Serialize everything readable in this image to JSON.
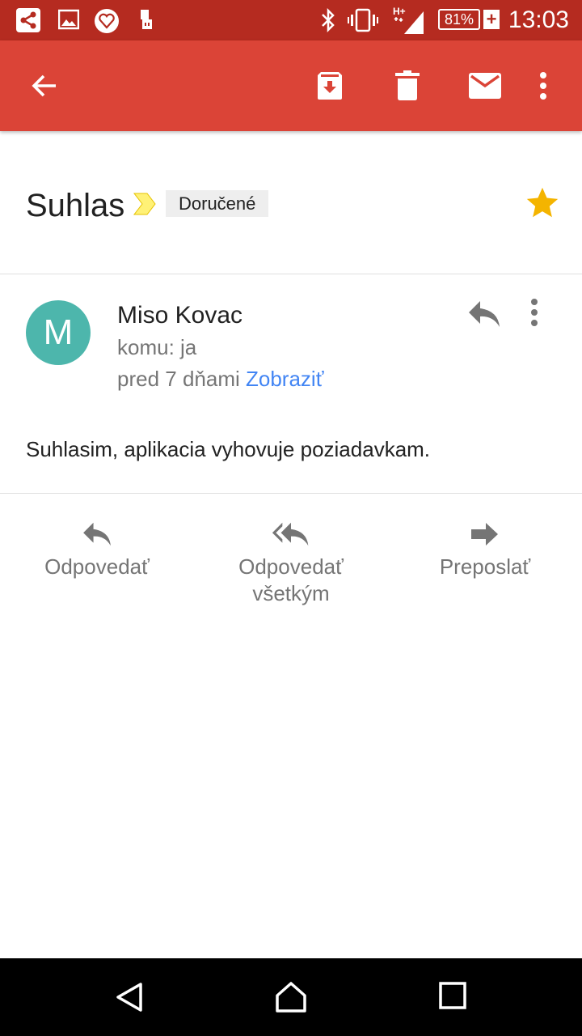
{
  "status_bar": {
    "time": "13:03",
    "battery": "81%",
    "battery_plus": "+",
    "network": "H+",
    "icons": [
      "share-icon",
      "image-icon",
      "heart-app-icon",
      "usb-icon",
      "bluetooth-icon",
      "vibrate-icon",
      "signal-icon"
    ]
  },
  "app_bar": {
    "background": "#db4437",
    "status_background": "#b52b20",
    "icons": [
      "back-arrow-icon",
      "archive-icon",
      "delete-icon",
      "mark-unread-icon",
      "more-vert-icon"
    ]
  },
  "email": {
    "subject": "Suhlas",
    "label": "Doručené",
    "starred": true,
    "sender_initial": "M",
    "sender_name": "Miso Kovac",
    "to": "komu: ja",
    "date": "pred 7 dňami",
    "show_link": "Zobraziť",
    "body": "Suhlasim, aplikacia vyhovuje poziadavkam."
  },
  "actions": {
    "reply": "Odpovedať",
    "reply_all_line1": "Odpovedať",
    "reply_all_line2": "všetkým",
    "forward": "Preposlať"
  },
  "colors": {
    "avatar": "#4db6ac",
    "star": "#f4b400",
    "link": "#4285f4",
    "important_marker": "#fff176"
  }
}
